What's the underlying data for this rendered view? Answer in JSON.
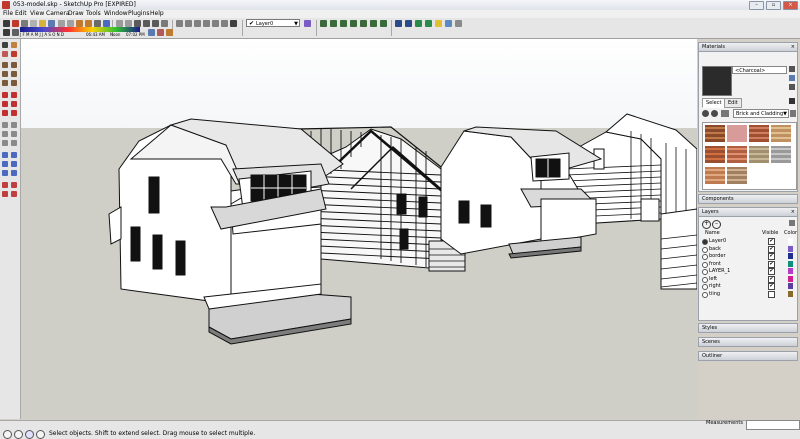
{
  "window": {
    "title": "053-model.skp - SketchUp Pro [EXPIRED]",
    "controls": [
      "minimize",
      "maximize",
      "close"
    ]
  },
  "menu": [
    "File",
    "Edit",
    "View",
    "Camera",
    "Draw",
    "Tools",
    "Window",
    "Plugins",
    "Help"
  ],
  "toolbar": {
    "layer_dropdown": "Layer0",
    "shadow": {
      "months": "J F M A M J J A S O N D",
      "time_start": "06:43 AM",
      "time_noon": "Noon",
      "time_end": "07:02 PM"
    }
  },
  "tray": {
    "materials": {
      "title": "Materials",
      "current_material": "<Charcoal>",
      "tabs": [
        "Select",
        "Edit"
      ],
      "library": "Brick and Cladding",
      "swatch_color": "#2b2b2b"
    },
    "components": {
      "title": "Components"
    },
    "layers": {
      "title": "Layers",
      "columns": [
        "Name",
        "Visible",
        "Color"
      ],
      "rows": [
        {
          "name": "Layer0",
          "active": true,
          "visible": true,
          "color": "#ffffff"
        },
        {
          "name": "back",
          "active": false,
          "visible": true,
          "color": "#7b5cc4"
        },
        {
          "name": "border",
          "active": false,
          "visible": true,
          "color": "#1f2f8f"
        },
        {
          "name": "front",
          "active": false,
          "visible": true,
          "color": "#0f8f7a"
        },
        {
          "name": "LAYER_1",
          "active": false,
          "visible": true,
          "color": "#b43cc9"
        },
        {
          "name": "left",
          "active": false,
          "visible": true,
          "color": "#d02090"
        },
        {
          "name": "right",
          "active": false,
          "visible": true,
          "color": "#5b3fa0"
        },
        {
          "name": "tiing",
          "active": false,
          "visible": false,
          "color": "#8a6a2a"
        }
      ]
    },
    "styles": {
      "title": "Styles"
    },
    "scenes": {
      "title": "Scenes"
    },
    "outliner": {
      "title": "Outliner"
    }
  },
  "status": {
    "message": "Select objects. Shift to extend select. Drag mouse to select multiple.",
    "measurements_label": "Measurements",
    "measurements_value": ""
  },
  "colors": {
    "sky": "#ffffff",
    "ground": "#cfcfc7",
    "chrome": "#d4d0c8"
  }
}
